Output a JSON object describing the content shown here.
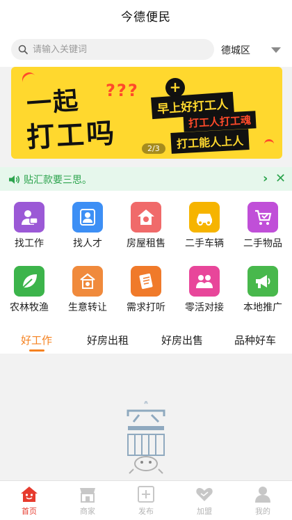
{
  "header": {
    "title": "今德便民"
  },
  "search": {
    "placeholder": "请输入关键词",
    "region": "德城区"
  },
  "banner": {
    "line1": "一起",
    "qmarks": "???",
    "line2": "打工吗",
    "plus": "+",
    "slogan1": "早上好打工人",
    "slogan2": "打工人打工魂",
    "slogan3": "打工能人上人",
    "pager": "2/3"
  },
  "notice": {
    "text": "贴汇款要三思。"
  },
  "categories": [
    {
      "label": "找工作",
      "icon": "job-icon",
      "color": "#9b59d6"
    },
    {
      "label": "找人才",
      "icon": "talent-icon",
      "color": "#3d8ff5"
    },
    {
      "label": "房屋租售",
      "icon": "house-icon",
      "color": "#f06a6a"
    },
    {
      "label": "二手车辆",
      "icon": "car-icon",
      "color": "#f6b400"
    },
    {
      "label": "二手物品",
      "icon": "cart-icon",
      "color": "#c04fd8"
    },
    {
      "label": "农林牧渔",
      "icon": "leaf-icon",
      "color": "#3cb44b"
    },
    {
      "label": "生意转让",
      "icon": "transfer-icon",
      "color": "#f08a3c"
    },
    {
      "label": "需求打听",
      "icon": "inquiry-icon",
      "color": "#f07a2a"
    },
    {
      "label": "零活对接",
      "icon": "people-icon",
      "color": "#e8469a"
    },
    {
      "label": "本地推广",
      "icon": "megaphone-icon",
      "color": "#48b84c"
    }
  ],
  "tabs": [
    "好工作",
    "好房出租",
    "好房出售",
    "品种好车"
  ],
  "bottom_nav": [
    {
      "label": "首页",
      "icon": "home-icon"
    },
    {
      "label": "商家",
      "icon": "shop-icon"
    },
    {
      "label": "发布",
      "icon": "publish-icon"
    },
    {
      "label": "加盟",
      "icon": "handshake-icon"
    },
    {
      "label": "我的",
      "icon": "user-icon"
    }
  ],
  "colors": {
    "accent": "#f58220",
    "nav_active": "#e63b2e",
    "notice_green": "#2da44e",
    "banner_yellow": "#ffd82e"
  }
}
